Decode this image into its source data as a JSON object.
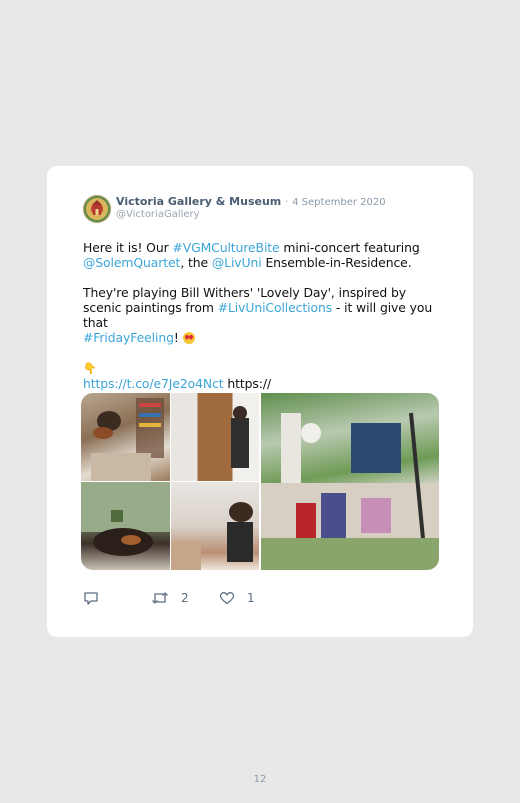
{
  "tweet": {
    "author_name": "Victoria Gallery & Museum",
    "separator": "·",
    "date": "4 September 2020",
    "handle": "@VictoriaGallery",
    "p1": {
      "t1": "Here it is! Our ",
      "tag1": "#VGMCultureBite",
      "t2": " mini-concert featuring",
      "mention1": "@SolemQuartet",
      "t3": ", the ",
      "mention2": "@LivUni",
      "t4": " Ensemble-in-Residence."
    },
    "p2": {
      "t1": "They're playing Bill Withers' 'Lovely Day', inspired by scenic paintings from ",
      "tag1": "#LivUniCollections",
      "t2": " - it will give you that ",
      "tag2": "#FridayFeeling",
      "t3": "!"
    },
    "p3": {
      "emoji": "👇",
      "link": "https://t.co/e7Je2o4Nct",
      "trail": " https://"
    },
    "actions": {
      "reply_icon": "reply-icon",
      "retweet_icon": "retweet-icon",
      "retweet_count": "2",
      "like_icon": "heart-icon",
      "like_count": "1"
    }
  },
  "page_number": "12",
  "colors": {
    "link": "#3ba5d8",
    "name": "#4a5d73",
    "background": "#e8e8e7"
  }
}
